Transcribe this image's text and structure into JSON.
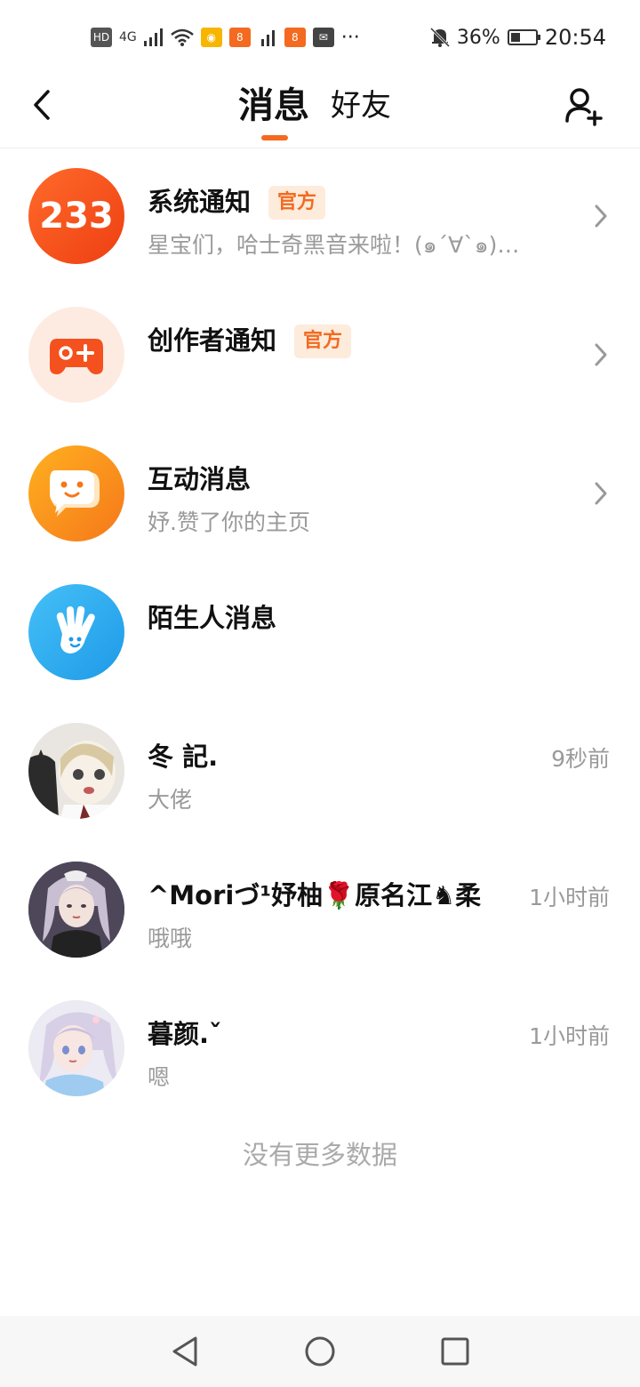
{
  "status_bar": {
    "left_icons": [
      "hd-icon",
      "signal-4g-icon",
      "wifi-icon",
      "weibo-icon",
      "app-icon",
      "signal-icon",
      "app-icon",
      "mail-icon",
      "more-icon"
    ],
    "hd": "HD",
    "net": "4G",
    "more": "···",
    "battery": "36%",
    "time": "20:54"
  },
  "header": {
    "tabs": [
      {
        "label": "消息",
        "active": true
      },
      {
        "label": "好友",
        "active": false
      }
    ],
    "accent_color": "#f36a20"
  },
  "rows": [
    {
      "title": "系统通知",
      "badge": "官方",
      "subtitle": "星宝们，哈士奇黑音来啦！(๑´∀`๑)…",
      "trailing": "chevron",
      "avatar_text": "233",
      "avatar_color": "#f04e1a"
    },
    {
      "title": "创作者通知",
      "badge": "官方",
      "subtitle": "",
      "trailing": "chevron",
      "avatar_icon": "gamepad-icon",
      "avatar_color": "#fdebe2"
    },
    {
      "title": "互动消息",
      "subtitle": "妤.赞了你的主页",
      "trailing": "chevron",
      "avatar_icon": "chat-face-icon",
      "avatar_color": "#f98a1a"
    },
    {
      "title": "陌生人消息",
      "subtitle": "",
      "trailing": "none",
      "avatar_icon": "hand-wave-icon",
      "avatar_color": "#2ea8f0"
    },
    {
      "title": "冬 記.",
      "subtitle": "大佬",
      "time": "9秒前"
    },
    {
      "title": "^Moriづ¹妤柚🌹原名江♞柔",
      "subtitle": "哦哦",
      "time": "1小时前"
    },
    {
      "title": "暮颜.ˇ",
      "subtitle": "嗯",
      "time": "1小时前"
    }
  ],
  "footer": "没有更多数据",
  "nav": [
    "back-triangle-icon",
    "home-circle-icon",
    "recents-square-icon"
  ]
}
